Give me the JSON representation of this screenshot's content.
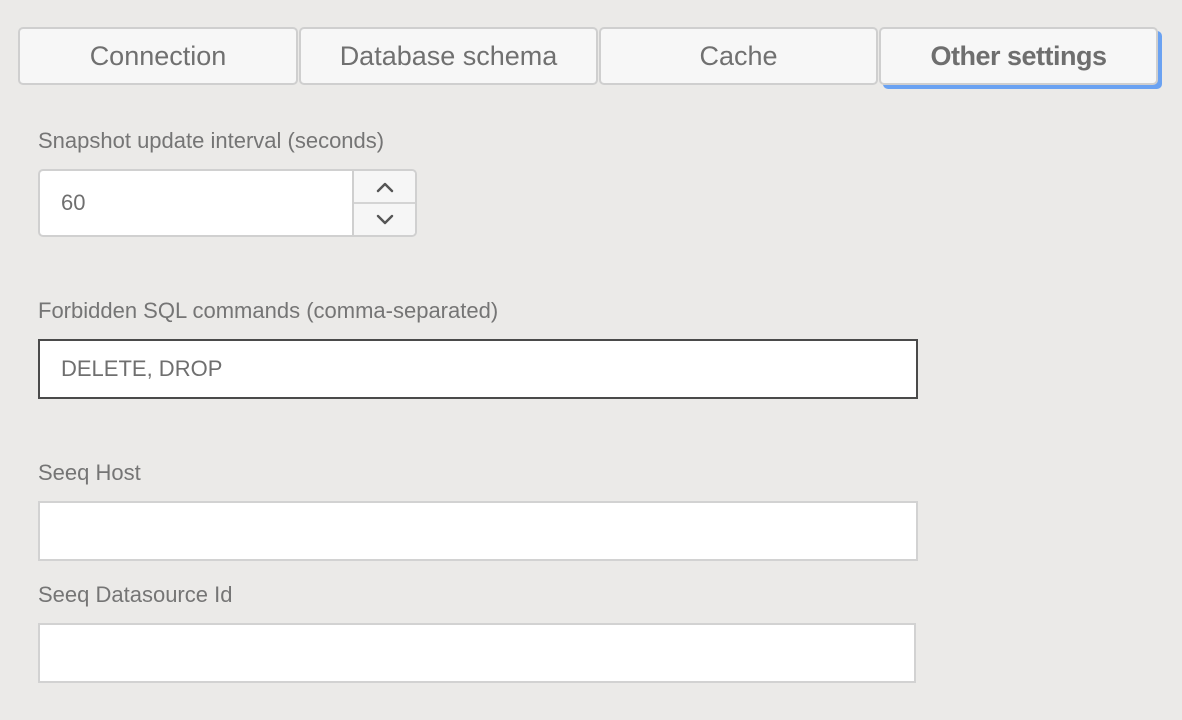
{
  "tabs": [
    {
      "label": "Connection",
      "active": false
    },
    {
      "label": "Database schema",
      "active": false
    },
    {
      "label": "Cache",
      "active": false
    },
    {
      "label": "Other settings",
      "active": true
    }
  ],
  "form": {
    "snapshot_interval": {
      "label": "Snapshot update interval (seconds)",
      "value": "60",
      "up_icon": "chevron-up-icon",
      "down_icon": "chevron-down-icon"
    },
    "forbidden_sql": {
      "label": "Forbidden SQL commands (comma-separated)",
      "value": "DELETE, DROP"
    },
    "seeq_host": {
      "label": "Seeq Host",
      "value": ""
    },
    "seeq_datasource_id": {
      "label": "Seeq Datasource Id",
      "value": ""
    }
  },
  "colors": {
    "background": "#ebeae8",
    "active_tab_shadow": "#6aa2f2",
    "text": "#757575"
  }
}
